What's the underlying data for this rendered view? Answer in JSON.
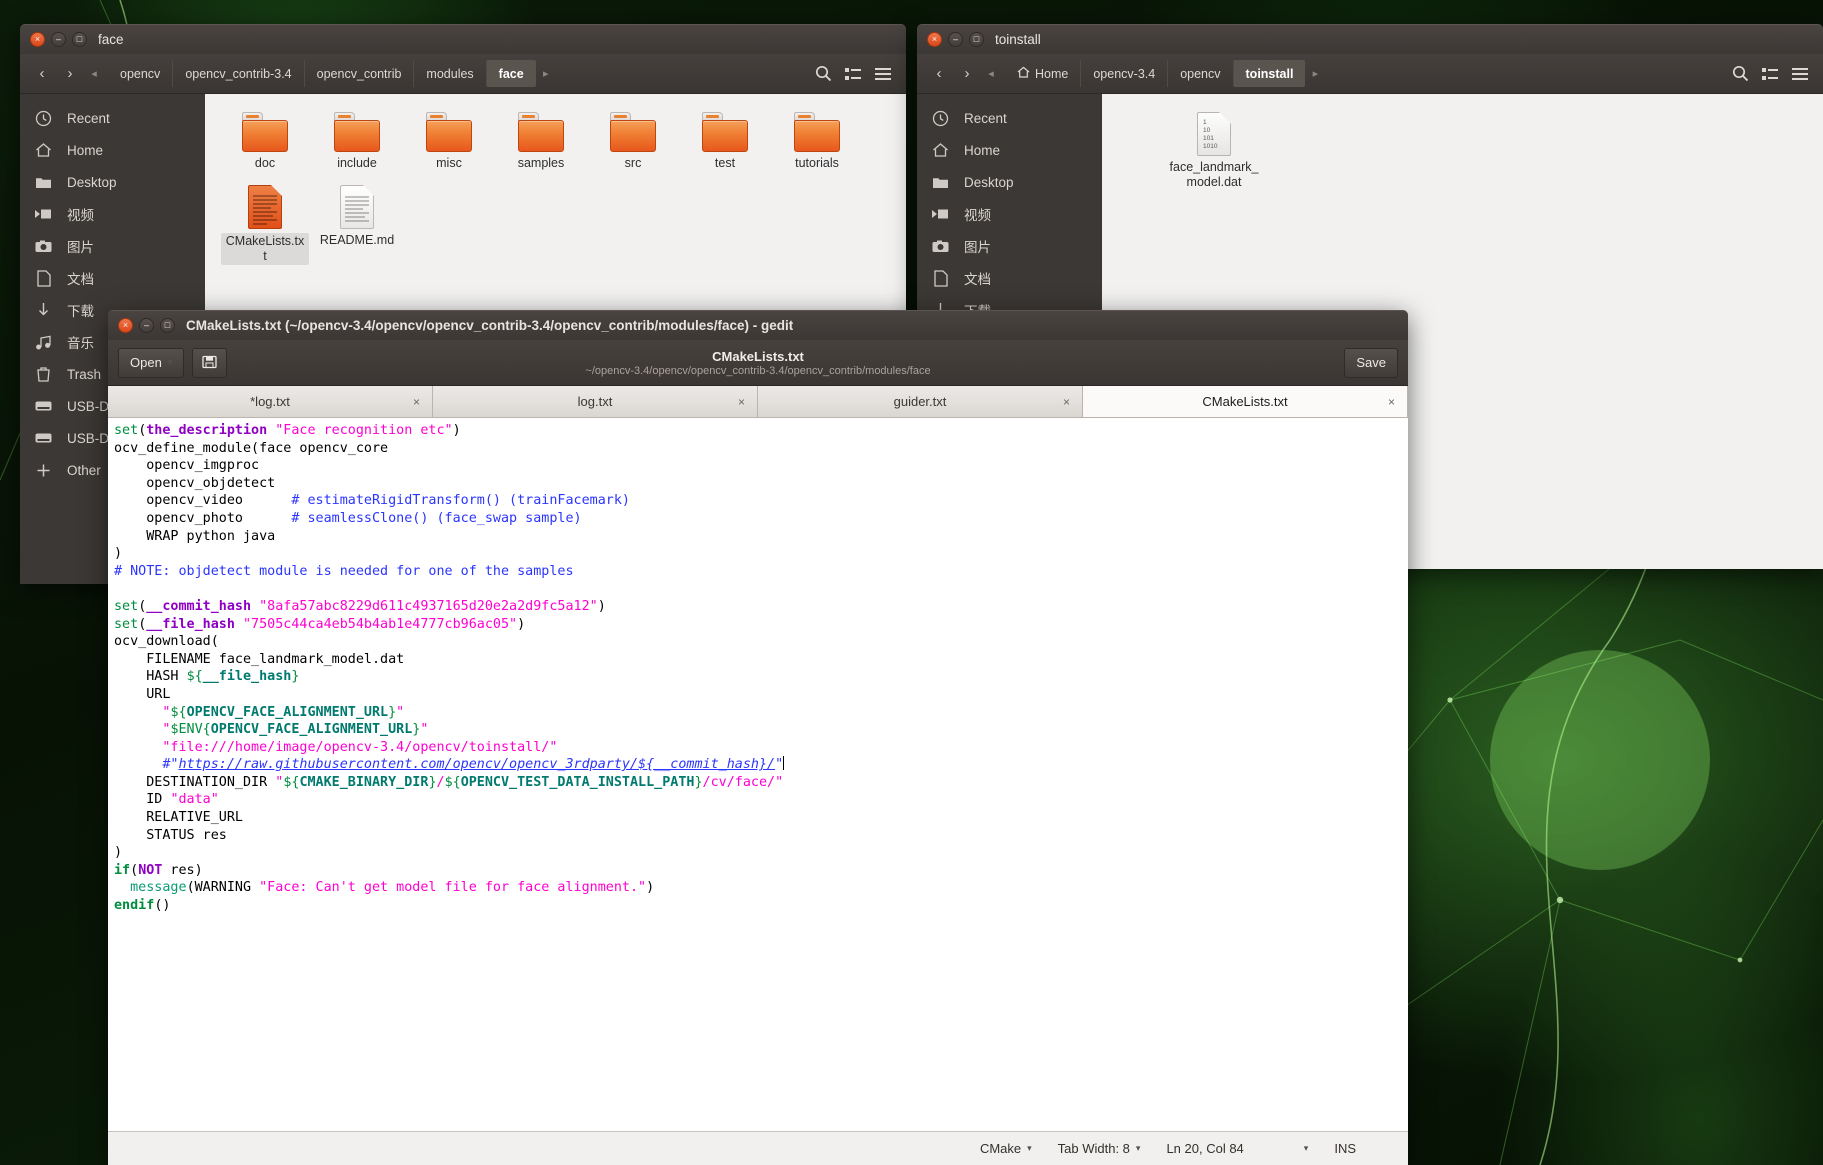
{
  "desktop": {
    "wallpaper_name": "green-neural-plexus"
  },
  "file_manager_left": {
    "title": "face",
    "window_buttons": {
      "close": "×",
      "minimize": "–",
      "maximize": "□"
    },
    "nav": {
      "back": "‹",
      "forward": "›",
      "crumb_prev": "◂",
      "crumb_next": "▸"
    },
    "breadcrumbs": [
      {
        "label": "opencv",
        "active": false
      },
      {
        "label": "opencv_contrib-3.4",
        "active": false
      },
      {
        "label": "opencv_contrib",
        "active": false
      },
      {
        "label": "modules",
        "active": false
      },
      {
        "label": "face",
        "active": true
      }
    ],
    "toolbar_icons": [
      "search-icon",
      "view-list-icon",
      "menu-icon"
    ],
    "places": [
      {
        "label": "Recent",
        "icon": "clock-icon"
      },
      {
        "label": "Home",
        "icon": "home-icon"
      },
      {
        "label": "Desktop",
        "icon": "folder-icon"
      },
      {
        "label": "视频",
        "icon": "video-icon"
      },
      {
        "label": "图片",
        "icon": "camera-icon"
      },
      {
        "label": "文档",
        "icon": "document-icon"
      },
      {
        "label": "下载",
        "icon": "download-icon"
      },
      {
        "label": "音乐",
        "icon": "music-icon"
      },
      {
        "label": "Trash",
        "icon": "trash-icon"
      },
      {
        "label": "USB-D",
        "icon": "drive-icon"
      },
      {
        "label": "USB-D",
        "icon": "drive-icon"
      },
      {
        "label": "Other",
        "icon": "plus-icon"
      }
    ],
    "files": [
      {
        "name": "doc",
        "type": "folder",
        "selected": false
      },
      {
        "name": "include",
        "type": "folder",
        "selected": false
      },
      {
        "name": "misc",
        "type": "folder",
        "selected": false
      },
      {
        "name": "samples",
        "type": "folder",
        "selected": false
      },
      {
        "name": "src",
        "type": "folder",
        "selected": false
      },
      {
        "name": "test",
        "type": "folder",
        "selected": false
      },
      {
        "name": "tutorials",
        "type": "folder",
        "selected": false
      },
      {
        "name": "CMakeLists.txt",
        "type": "text",
        "selected": true
      },
      {
        "name": "README.md",
        "type": "plain",
        "selected": false
      }
    ]
  },
  "file_manager_right": {
    "title": "toinstall",
    "breadcrumbs": [
      {
        "label": "Home",
        "active": false,
        "icon": "home-icon"
      },
      {
        "label": "opencv-3.4",
        "active": false
      },
      {
        "label": "opencv",
        "active": false
      },
      {
        "label": "toinstall",
        "active": true
      }
    ],
    "places": [
      {
        "label": "Recent",
        "icon": "clock-icon"
      },
      {
        "label": "Home",
        "icon": "home-icon"
      },
      {
        "label": "Desktop",
        "icon": "folder-icon"
      },
      {
        "label": "视频",
        "icon": "video-icon"
      },
      {
        "label": "图片",
        "icon": "camera-icon"
      },
      {
        "label": "文档",
        "icon": "document-icon"
      },
      {
        "label": "下载",
        "icon": "download-icon"
      }
    ],
    "files": [
      {
        "name": "face_landmark_model.dat",
        "type": "binary",
        "selected": false
      }
    ]
  },
  "gedit": {
    "window_title": "CMakeLists.txt (~/opencv-3.4/opencv/opencv_contrib-3.4/opencv_contrib/modules/face) - gedit",
    "open_button": "Open",
    "open_caret": "▾",
    "newtab_icon": "save-as-icon",
    "header_title": "CMakeLists.txt",
    "header_subtitle": "~/opencv-3.4/opencv/opencv_contrib-3.4/opencv_contrib/modules/face",
    "save_button": "Save",
    "tabs": [
      {
        "label": "*log.txt",
        "active": false,
        "close": "×"
      },
      {
        "label": "log.txt",
        "active": false,
        "close": "×"
      },
      {
        "label": "guider.txt",
        "active": false,
        "close": "×"
      },
      {
        "label": "CMakeLists.txt",
        "active": true,
        "close": "×"
      }
    ],
    "statusbar": {
      "language": "CMake",
      "tab_width": "Tab Width: 8",
      "position": "Ln 20, Col 84",
      "insert_mode": "INS",
      "caret": "▾"
    },
    "document_text": [
      "set(the_description \"Face recognition etc\")",
      "ocv_define_module(face opencv_core",
      "    opencv_imgproc",
      "    opencv_objdetect",
      "    opencv_video      # estimateRigidTransform() (trainFacemark)",
      "    opencv_photo      # seamlessClone() (face_swap sample)",
      "    WRAP python java",
      ")",
      "# NOTE: objdetect module is needed for one of the samples",
      "",
      "set(__commit_hash \"8afa57abc8229d611c4937165d20e2a2d9fc5a12\")",
      "set(__file_hash \"7505c44ca4eb54b4ab1e4777cb96ac05\")",
      "ocv_download(",
      "    FILENAME face_landmark_model.dat",
      "    HASH ${__file_hash}",
      "    URL",
      "      \"${OPENCV_FACE_ALIGNMENT_URL}\"",
      "      \"$ENV{OPENCV_FACE_ALIGNMENT_URL}\"",
      "      \"file:///home/image/opencv-3.4/opencv/toinstall/\"",
      "      #\"https://raw.githubusercontent.com/opencv/opencv_3rdparty/${__commit_hash}/\"",
      "    DESTINATION_DIR \"${CMAKE_BINARY_DIR}/${OPENCV_TEST_DATA_INSTALL_PATH}/cv/face/\"",
      "    ID \"data\"",
      "    RELATIVE_URL",
      "    STATUS res",
      ")",
      "if(NOT res)",
      "  message(WARNING \"Face: Can't get model file for face alignment.\")",
      "endif()"
    ]
  },
  "colors": {
    "accent_orange": "#e8571d",
    "chrome_dark": "#3c3835",
    "code_string": "#ff00d0",
    "code_comment": "#2b35ff",
    "code_keyword": "#008d3f",
    "code_variable": "#8f00c4"
  }
}
